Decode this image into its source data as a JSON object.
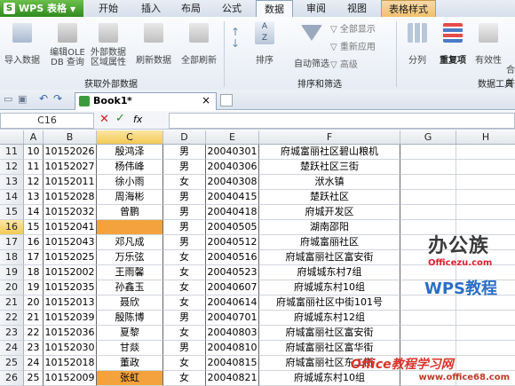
{
  "app": {
    "title": "WPS 表格"
  },
  "ribbon_tabs": [
    "开始",
    "插入",
    "布局",
    "公式",
    "数据",
    "审阅",
    "视图",
    "表格样式"
  ],
  "ribbon": {
    "group1": {
      "buttons": [
        "导入数据",
        "编辑OLE DB 查询",
        "外部数据 区域属性",
        "刷新数据",
        "全部刷新"
      ],
      "label": "获取外部数据"
    },
    "group2": {
      "buttons": [
        "排序",
        "自动筛选"
      ],
      "small": [
        "全部显示",
        "重新应用",
        "高级"
      ],
      "label": "排序和筛选"
    },
    "group3": {
      "buttons": [
        "分列",
        "重复项",
        "有效性",
        "合并"
      ],
      "label": "数据工具"
    }
  },
  "doc_tab": {
    "name": "Book1",
    "modified": "*"
  },
  "formula_bar": {
    "cell_ref": "C16",
    "fx": "fx"
  },
  "columns": [
    "A",
    "B",
    "C",
    "D",
    "E",
    "F",
    "G",
    "H"
  ],
  "selected_column": "C",
  "selected_row": "16",
  "rows": [
    {
      "n": "11",
      "a": "10",
      "b": "10152026",
      "c": "殷鸿泽",
      "d": "男",
      "e": "20040301",
      "f": "府城富丽社区碧山粮机"
    },
    {
      "n": "12",
      "a": "11",
      "b": "10152027",
      "c": "杨伟峰",
      "d": "男",
      "e": "20040306",
      "f": "楚跃社区三街"
    },
    {
      "n": "13",
      "a": "12",
      "b": "10152011",
      "c": "徐小雨",
      "d": "女",
      "e": "20040308",
      "f": "洑水镇"
    },
    {
      "n": "14",
      "a": "13",
      "b": "10152028",
      "c": "周海彬",
      "d": "男",
      "e": "20040415",
      "f": "楚跃社区"
    },
    {
      "n": "15",
      "a": "14",
      "b": "10152032",
      "c": "曾鹏",
      "d": "男",
      "e": "20040418",
      "f": "府城开发区"
    },
    {
      "n": "16",
      "a": "15",
      "b": "10152041",
      "c": "",
      "d": "男",
      "e": "20040505",
      "f": "湖南邵阳"
    },
    {
      "n": "17",
      "a": "16",
      "b": "10152043",
      "c": "邓凡成",
      "d": "男",
      "e": "20040512",
      "f": "府城富丽社区"
    },
    {
      "n": "18",
      "a": "17",
      "b": "10152025",
      "c": "万乐弦",
      "d": "女",
      "e": "20040516",
      "f": "府城富丽社区富安街"
    },
    {
      "n": "19",
      "a": "18",
      "b": "10152002",
      "c": "王雨馨",
      "d": "女",
      "e": "20040523",
      "f": "府城城东村7组"
    },
    {
      "n": "20",
      "a": "19",
      "b": "10152035",
      "c": "孙鑫玉",
      "d": "女",
      "e": "20040607",
      "f": "府城城东村10组"
    },
    {
      "n": "21",
      "a": "20",
      "b": "10152013",
      "c": "聂欣",
      "d": "女",
      "e": "20040614",
      "f": "府城富丽社区中街101号"
    },
    {
      "n": "22",
      "a": "21",
      "b": "10152039",
      "c": "殷陈博",
      "d": "男",
      "e": "20040701",
      "f": "府城城东村12组"
    },
    {
      "n": "23",
      "a": "22",
      "b": "10152036",
      "c": "夏黎",
      "d": "女",
      "e": "20040803",
      "f": "府城富丽社区富安街"
    },
    {
      "n": "24",
      "a": "23",
      "b": "10152030",
      "c": "甘燚",
      "d": "男",
      "e": "20040810",
      "f": "府城富丽社区富华街"
    },
    {
      "n": "25",
      "a": "24",
      "b": "10152018",
      "c": "董政",
      "d": "女",
      "e": "20040815",
      "f": "府城富丽社区东二街"
    },
    {
      "n": "26",
      "a": "25",
      "b": "10152009",
      "c": "张虹",
      "d": "女",
      "e": "20040821",
      "f": "府城城东村10组"
    }
  ],
  "highlighted_rows": [
    "16",
    "26"
  ],
  "watermark": {
    "logo": "办公族",
    "site": "Officezu.com",
    "wps": "WPS教程",
    "footer": "Office教程学习网",
    "footer_url": "www.office68.com"
  },
  "colors": {
    "accent_green": "#2f8a1e",
    "highlight": "#f4a23d",
    "selected_header": "#f3c955"
  }
}
